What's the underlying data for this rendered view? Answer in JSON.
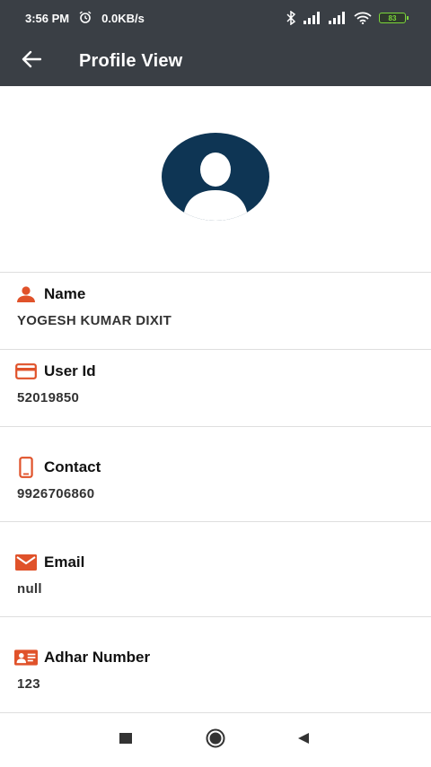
{
  "status_bar": {
    "time": "3:56 PM",
    "net_speed": "0.0KB/s",
    "battery": "83"
  },
  "app_bar": {
    "title": "Profile View"
  },
  "fields": [
    {
      "label": "Name",
      "value": "YOGESH KUMAR DIXIT",
      "icon": "person-icon"
    },
    {
      "label": "User Id",
      "value": "52019850",
      "icon": "card-icon"
    },
    {
      "label": "Contact",
      "value": "9926706860",
      "icon": "phone-icon"
    },
    {
      "label": "Email",
      "value": "null",
      "icon": "mail-icon"
    },
    {
      "label": "Adhar Number",
      "value": "123",
      "icon": "id-card-icon"
    }
  ],
  "colors": {
    "app_bar": "#3a3f45",
    "accent": "#e0522a",
    "avatar_bg": "#0e3554"
  }
}
